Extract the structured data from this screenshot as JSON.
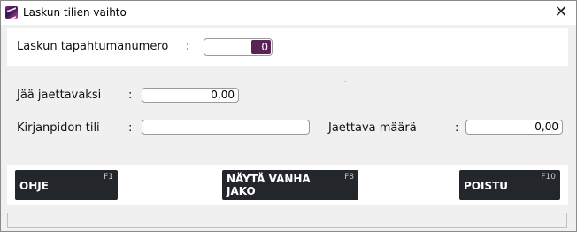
{
  "window": {
    "title": "Laskun tilien vaihto",
    "close_glyph": "✕"
  },
  "header_panel": {
    "label": "Laskun tapahtumanumero",
    "colon": ":",
    "value": "0"
  },
  "form": {
    "remaining_label": "Jää jaettavaksi",
    "remaining_colon": ":",
    "remaining_value": "0,00",
    "account_label": "Kirjanpidon tili",
    "account_colon": ":",
    "account_value": "",
    "amount_label": "Jaettava määrä",
    "amount_colon": ":",
    "amount_value": "0,00"
  },
  "buttons": {
    "help": {
      "label": "OHJE",
      "key": "F1"
    },
    "show_old": {
      "label_line1": "NÄYTÄ VANHA",
      "label_line2": "JAKO",
      "key": "F8"
    },
    "exit": {
      "label": "POISTU",
      "key": "F10"
    }
  },
  "colors": {
    "button_bg": "#23262b",
    "selection": "#5a2356",
    "window_bg": "#f0f0f0"
  }
}
